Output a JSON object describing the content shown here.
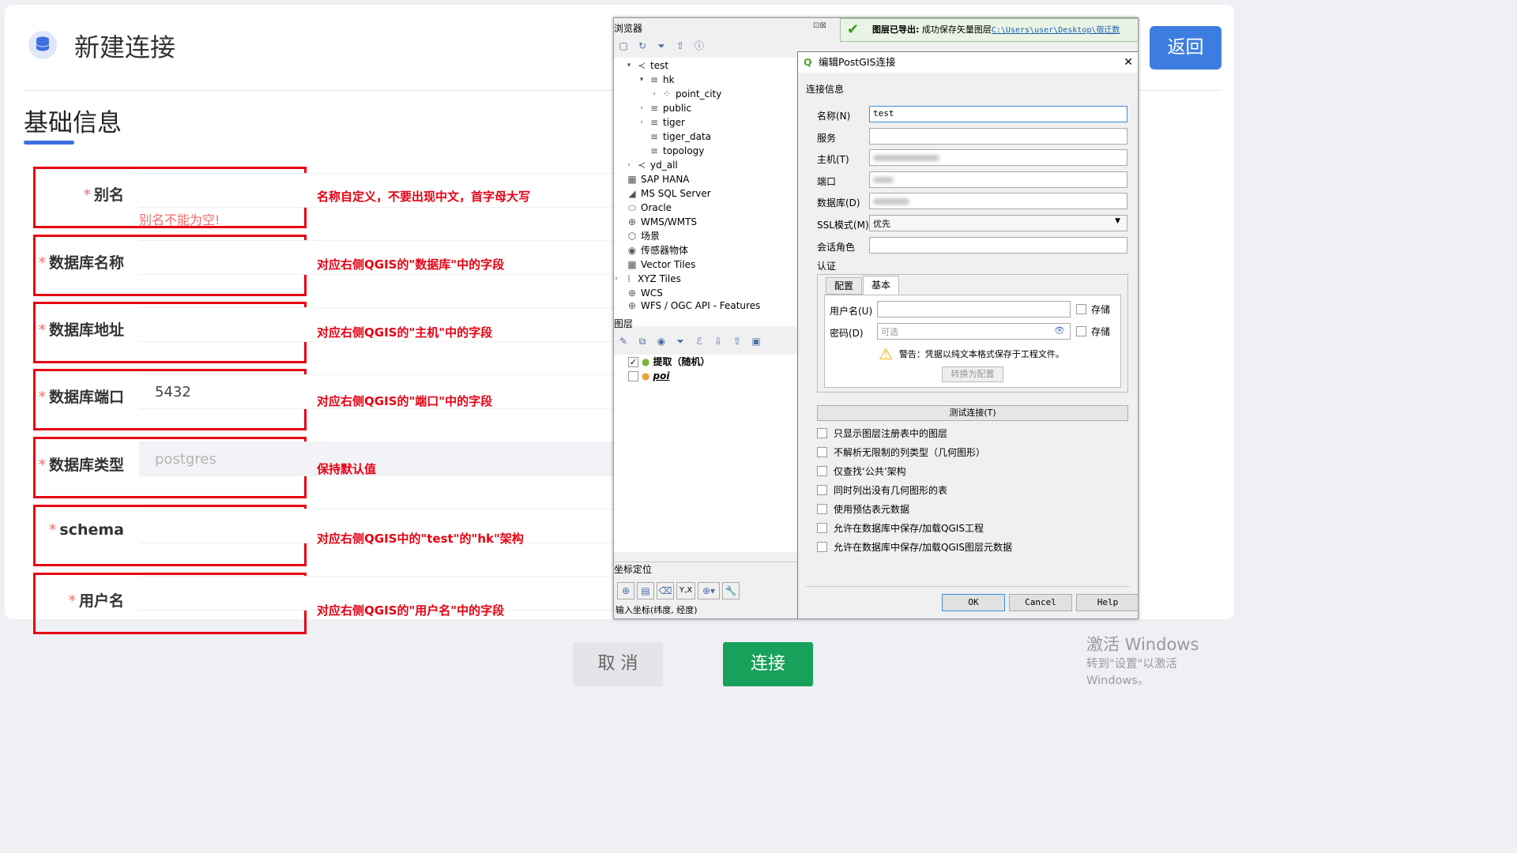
{
  "header": {
    "title": "新建连接",
    "back_label": "返回"
  },
  "section": {
    "title": "基础信息"
  },
  "form": {
    "fields": [
      {
        "label": "别名",
        "value": "",
        "error": "别名不能为空!",
        "note": "名称自定义，不要出现中文，首字母大写"
      },
      {
        "label": "数据库名称",
        "value": "",
        "note": "对应右侧QGIS的\"数据库\"中的字段"
      },
      {
        "label": "数据库地址",
        "value": "",
        "note": "对应右侧QGIS的\"主机\"中的字段"
      },
      {
        "label": "数据库端口",
        "value": "5432",
        "note": "对应右侧QGIS的\"端口\"中的字段"
      },
      {
        "label": "数据库类型",
        "value": "postgres",
        "disabled": true,
        "note": "保持默认值"
      },
      {
        "label": "schema",
        "value": "",
        "note": "对应右侧QGIS中的\"test\"的\"hk\"架构"
      },
      {
        "label": "用户名",
        "value": "",
        "note": "对应右侧QGIS的\"用户名\"中的字段"
      }
    ],
    "required_mark": "*"
  },
  "footer": {
    "cancel_label": "取 消",
    "connect_label": "连接"
  },
  "watermark": {
    "line1": "激活 Windows",
    "line2": "转到\"设置\"以激活 Windows。"
  },
  "qgis": {
    "browser": {
      "title": "浏览器",
      "tree": [
        {
          "label": "test",
          "icon": "postgis-icon"
        },
        {
          "label": "hk",
          "icon": "schema-icon"
        },
        {
          "label": "point_city",
          "icon": "point-layer-icon"
        },
        {
          "label": "public",
          "icon": "schema-icon"
        },
        {
          "label": "tiger",
          "icon": "schema-icon"
        },
        {
          "label": "tiger_data",
          "icon": "schema-icon"
        },
        {
          "label": "topology",
          "icon": "schema-icon"
        },
        {
          "label": "yd_all",
          "icon": "postgis-icon"
        },
        {
          "label": "SAP HANA",
          "icon": "hana-icon"
        },
        {
          "label": "MS SQL Server",
          "icon": "mssql-icon"
        },
        {
          "label": "Oracle",
          "icon": "oracle-icon"
        },
        {
          "label": "WMS/WMTS",
          "icon": "wms-icon"
        },
        {
          "label": "场景",
          "icon": "scene-icon"
        },
        {
          "label": "传感器物体",
          "icon": "sensor-icon"
        },
        {
          "label": "Vector Tiles",
          "icon": "vector-tiles-icon"
        },
        {
          "label": "XYZ Tiles",
          "icon": "xyz-icon"
        },
        {
          "label": "WCS",
          "icon": "wcs-icon"
        },
        {
          "label": "WFS / OGC API - Features",
          "icon": "wfs-icon"
        }
      ]
    },
    "layers": {
      "title": "图层",
      "items": [
        {
          "label": "提取（随机）",
          "checked": true
        },
        {
          "label": "poi",
          "checked": false
        }
      ]
    },
    "coords": {
      "title": "坐标定位",
      "hint": "输入坐标(纬度, 经度)",
      "yx": "Y,X"
    },
    "message": {
      "prefix": "图层已导出:",
      "text": "成功保存矢量图层",
      "link": "C:\\Users\\user\\Desktop\\宿迁数"
    },
    "dialog": {
      "title": "编辑PostGIS连接",
      "section": "连接信息",
      "name_label": "名称(N)",
      "name_value": "test",
      "service_label": "服务",
      "host_label": "主机(T)",
      "port_label": "端口",
      "db_label": "数据库(D)",
      "ssl_label": "SSL模式(M)",
      "ssl_value": "优先",
      "role_label": "会话角色",
      "auth_label": "认证",
      "tab_config": "配置",
      "tab_basic": "基本",
      "user_label": "用户名(U)",
      "pass_label": "密码(D)",
      "pass_placeholder": "可选",
      "store_label": "存储",
      "warning": "警告：凭据以纯文本格式保存于工程文件。",
      "convert_label": "转换为配置",
      "test_label": "测试连接(T)",
      "options": [
        "只显示图层注册表中的图层",
        "不解析无限制的列类型（几何图形）",
        "仅查找‘公共’架构",
        "同时列出没有几何图形的表",
        "使用预估表元数据",
        "允许在数据库中保存/加载QGIS工程",
        "允许在数据库中保存/加载QGIS图层元数据"
      ],
      "ok_label": "OK",
      "cancel_label": "Cancel",
      "help_label": "Help"
    }
  }
}
